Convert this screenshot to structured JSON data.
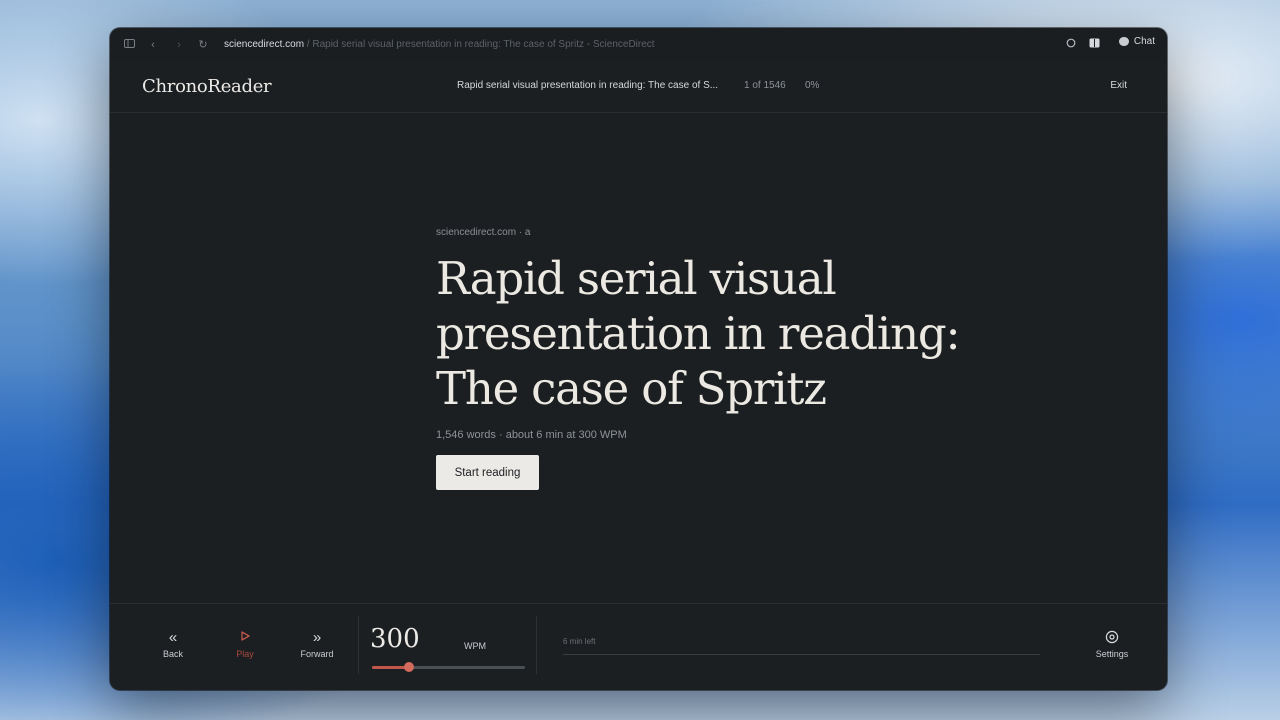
{
  "browser": {
    "url_host": "sciencedirect.com",
    "url_path": " / Rapid serial visual presentation in reading: The case of Spritz - ScienceDirect",
    "chat_label": "Chat"
  },
  "header": {
    "logo": "ChronoReader",
    "doc_title": "Rapid serial visual presentation in reading: The case of S...",
    "position": "1 of 1546",
    "percent": "0%",
    "exit_label": "Exit"
  },
  "article": {
    "source": "sciencedirect.com · a",
    "title": "Rapid serial visual presentation in reading: The case of Spritz",
    "meta": "1,546 words · about 6 min at 300 WPM",
    "start_label": "Start reading"
  },
  "controls": {
    "back_label": "Back",
    "play_label": "Play",
    "forward_label": "Forward",
    "wpm_value": "300",
    "wpm_unit": "WPM",
    "wpm_slider_fraction": 0.24,
    "time_left": "6 min left",
    "progress_fraction": 0.0,
    "settings_label": "Settings"
  },
  "icons": {
    "back": "double-chevron-left-icon",
    "play": "play-icon",
    "forward": "double-chevron-right-icon",
    "settings": "gear-icon"
  },
  "colors": {
    "accent": "#c0574a",
    "background": "#1c1f22",
    "text": "#ece9e3"
  }
}
